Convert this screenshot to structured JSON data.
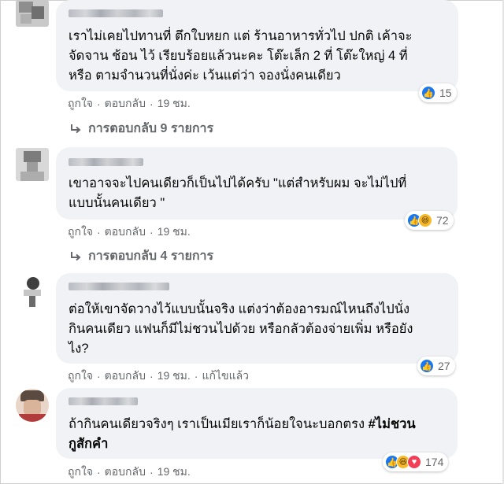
{
  "comments": [
    {
      "text_lines": [
        "เราไม่เคยไปทานที่ ตึกใบหยก แต่ ร้านอาหารทั่วไป ปกติ เค้าจะ",
        "จัดจาน ช้อน ไว้ เรียบร้อยแล้วนะคะ โต๊ะเล็ก 2 ที่ โต๊ะใหญ่ 4 ที่",
        "หรือ ตามจำนวนที่นั่งค่ะ เว้นแต่ว่า จองนั่งคนเดียว"
      ],
      "like_label": "ถูกใจ",
      "reply_label": "ตอบกลับ",
      "time": "19 ชม.",
      "reaction_count": "15",
      "reaction_icons": [
        "like-icon"
      ],
      "replies_label": "การตอบกลับ 9 รายการ"
    },
    {
      "text_lines": [
        "เขาอาจจะไปคนเดียวก็เป็นไปได้ครับ \"แต่สำหรับผม จะไม่ไปที่",
        "แบบนั้นคนเดียว \""
      ],
      "like_label": "ถูกใจ",
      "reply_label": "ตอบกลับ",
      "time": "19 ชม.",
      "reaction_count": "72",
      "reaction_icons": [
        "like-icon",
        "haha-icon"
      ],
      "replies_label": "การตอบกลับ 4 รายการ"
    },
    {
      "text_lines": [
        "ต่อให้เขาจัดวางไว้แบบนั้นจริง แต่งว่าต้องอารมณ์ไหนถึงไปนั่ง",
        "กินคนเดียว แฟนก็มีไม่ชวนไปด้วย หรือกลัวต้องจ่ายเพิ่ม หรือยัง",
        "ไง?"
      ],
      "like_label": "ถูกใจ",
      "reply_label": "ตอบกลับ",
      "time": "19 ชม.",
      "edited_label": "แก้ไขแล้ว",
      "reaction_count": "27",
      "reaction_icons": [
        "like-icon"
      ]
    },
    {
      "text_line1_prefix": "ถ้ากินคนเดียวจริงๆ เราเป็นเมียเราก็น้อยใจนะบอกตรง ",
      "text_hashtag_part1": "#ไม่ชวน",
      "text_hashtag_part2": "กูสักคำ",
      "like_label": "ถูกใจ",
      "reply_label": "ตอบกลับ",
      "time": "19 ชม.",
      "reaction_count": "174",
      "reaction_icons": [
        "like-icon",
        "haha-icon",
        "love-icon"
      ]
    }
  ],
  "separator": "·",
  "colors": {
    "bubble": "#f0f2f5",
    "meta_text": "#65676b",
    "like_blue": "#1877f2",
    "haha_yellow": "#f7b928",
    "love_red": "#f33e58"
  }
}
